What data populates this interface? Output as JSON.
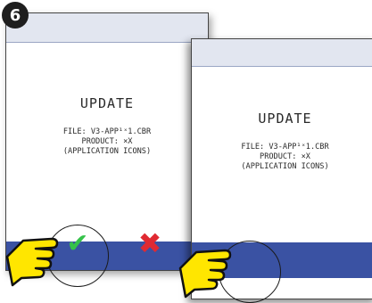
{
  "step": {
    "number": "6"
  },
  "screen_left": {
    "title": "UPDATE",
    "lines": [
      "FILE: V3-APP¹ˣ1.CBR",
      "PRODUCT: ×X",
      "(APPLICATION ICONS)"
    ],
    "confirm_symbol": "✔",
    "cancel_symbol": "✖"
  },
  "screen_right": {
    "title": "UPDATE",
    "lines": [
      "FILE: V3-APP¹ˣ1.CBR",
      "PRODUCT: ×X",
      "(APPLICATION ICONS)"
    ]
  },
  "colors": {
    "bottom_bar": "#3a52a3",
    "confirm": "#35c24a",
    "cancel": "#e02a32",
    "hand": "#ffe600"
  },
  "icons": {
    "confirm": "checkmark-icon",
    "cancel": "x-icon",
    "pointer": "pointing-hand-icon"
  }
}
